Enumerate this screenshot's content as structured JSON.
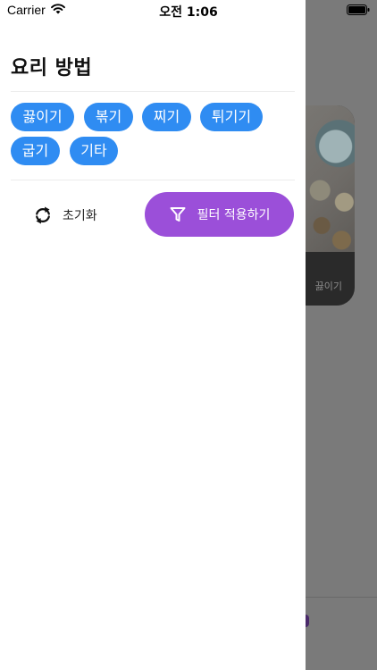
{
  "status_bar": {
    "carrier": "Carrier",
    "time": "오전 1:06",
    "wifi_icon": "wifi-icon",
    "battery_icon": "battery-icon"
  },
  "drawer": {
    "title": "요리 방법",
    "chips": [
      {
        "label": "끓이기"
      },
      {
        "label": "볶기"
      },
      {
        "label": "찌기"
      },
      {
        "label": "튀기기"
      },
      {
        "label": "굽기"
      },
      {
        "label": "기타"
      }
    ],
    "reset": {
      "label": "초기화",
      "icon": "refresh-icon"
    },
    "apply": {
      "label": "필터 적용하기",
      "icon": "filter-icon"
    }
  },
  "background": {
    "card_label": "끓이기"
  },
  "colors": {
    "chip_blue": "#2f8cf2",
    "apply_purple": "#9b4fd9",
    "overlay_gray": "#7a7a7a"
  }
}
